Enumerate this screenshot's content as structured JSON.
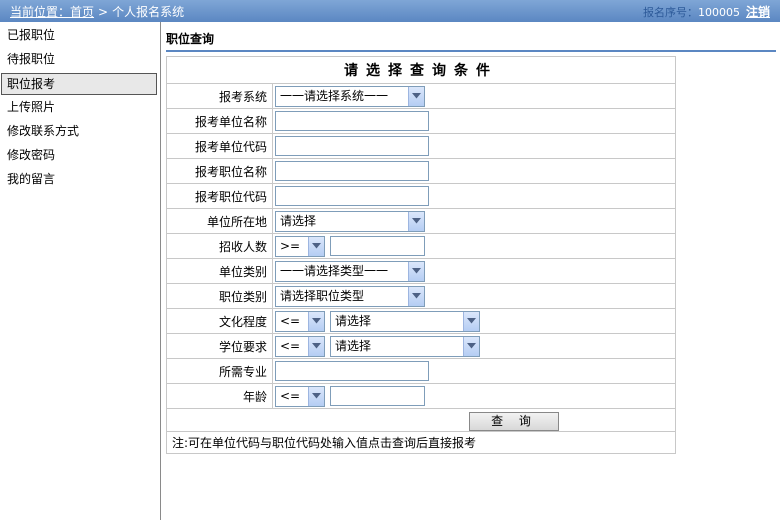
{
  "header": {
    "location_label": "当前位置：",
    "home_link": "首页",
    "separator": ">",
    "current_page": "个人报名系统",
    "serial_label": "报名序号：",
    "serial_value": "100005",
    "logout_label": "注销"
  },
  "sidebar": {
    "items": [
      {
        "label": "已报职位"
      },
      {
        "label": "待报职位"
      },
      {
        "label": "职位报考",
        "active": true
      },
      {
        "label": "上传照片"
      },
      {
        "label": "修改联系方式"
      },
      {
        "label": "修改密码"
      },
      {
        "label": "我的留言"
      }
    ]
  },
  "main": {
    "title": "职位查询",
    "form_header": "请选择查询条件",
    "fields": {
      "system": {
        "label": "报考系统",
        "value": "一一请选择系统一一"
      },
      "unit_name": {
        "label": "报考单位名称",
        "value": ""
      },
      "unit_code": {
        "label": "报考单位代码",
        "value": ""
      },
      "position_name": {
        "label": "报考职位名称",
        "value": ""
      },
      "position_code": {
        "label": "报考职位代码",
        "value": ""
      },
      "location": {
        "label": "单位所在地",
        "value": "请选择"
      },
      "headcount": {
        "label": "招收人数",
        "operator": ">=",
        "value": ""
      },
      "unit_type": {
        "label": "单位类别",
        "value": "一一请选择类型一一"
      },
      "position_type": {
        "label": "职位类别",
        "value": "请选择职位类型"
      },
      "education": {
        "label": "文化程度",
        "operator": "<=",
        "value": "请选择"
      },
      "degree": {
        "label": "学位要求",
        "operator": "<=",
        "value": "请选择"
      },
      "major": {
        "label": "所需专业",
        "value": ""
      },
      "age": {
        "label": "年龄",
        "operator": "<=",
        "value": ""
      }
    },
    "query_button": "查 询",
    "note": "注:可在单位代码与职位代码处输入值点击查询后直接报考"
  },
  "colors": {
    "header_bg": "#6a95cc",
    "accent": "#5b87c2",
    "serial_label": "#2d5a99"
  }
}
